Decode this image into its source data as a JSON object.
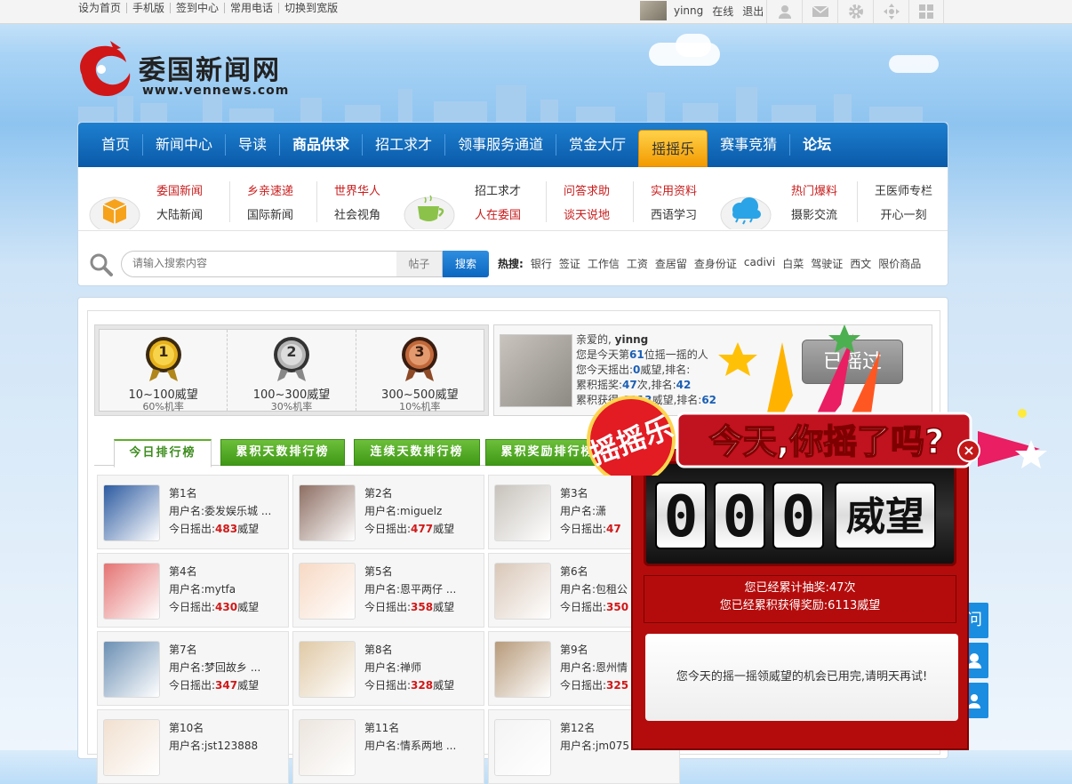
{
  "topbar": {
    "links": [
      "设为首页",
      "手机版",
      "签到中心",
      "常用电话",
      "切换到宽版"
    ],
    "username": "yinng",
    "status": "在线",
    "logout": "退出",
    "icons": [
      "user-icon",
      "mail-icon",
      "gear-icon",
      "move-icon",
      "grid-icon"
    ]
  },
  "logo": {
    "name": "委国新闻网",
    "url": "www.vennews.com"
  },
  "nav": {
    "items": [
      {
        "label": "首页"
      },
      {
        "label": "新闻中心"
      },
      {
        "label": "导读"
      },
      {
        "label": "商品供求"
      },
      {
        "label": "招工求才"
      },
      {
        "label": "领事服务通道"
      },
      {
        "label": "赏金大厅"
      },
      {
        "label": "摇摇乐"
      },
      {
        "label": "赛事竞猜"
      },
      {
        "label": "论坛"
      }
    ]
  },
  "subnav": {
    "groups": [
      [
        "委国新闻",
        "大陆新闻"
      ],
      [
        "乡亲速递",
        "国际新闻"
      ],
      [
        "世界华人",
        "社会视角"
      ],
      [
        "招工求才",
        "人在委国"
      ],
      [
        "问答求助",
        "谈天说地"
      ],
      [
        "实用资料",
        "西语学习"
      ],
      [
        "热门爆料",
        "摄影交流"
      ],
      [
        "王医师专栏",
        "开心一刻"
      ]
    ]
  },
  "search": {
    "placeholder": "请输入搜索内容",
    "type": "帖子",
    "button": "搜索",
    "hot_label": "热搜:",
    "hot_terms": [
      "银行",
      "签证",
      "工作信",
      "工资",
      "查居留",
      "查身份证",
      "cadivi",
      "白菜",
      "驾驶证",
      "西文",
      "限价商品"
    ]
  },
  "medals": [
    {
      "num": "1",
      "range": "10~100威望",
      "rate": "60%机率"
    },
    {
      "num": "2",
      "range": "100~300威望",
      "rate": "30%机率"
    },
    {
      "num": "3",
      "range": "300~500威望",
      "rate": "10%机率"
    }
  ],
  "usercard": {
    "greeting": "亲爱的,",
    "name": "yinng",
    "line2_pre": "您是今天第",
    "line2_num": "61",
    "line2_post": "位摇一摇的人",
    "line3": "您今天摇出:",
    "line3_num": "0",
    "line3_post": "威望,排名:",
    "line4": "累积摇奖:",
    "line4_num": "47",
    "line4_post": "次,排名:",
    "line4_rank": "42",
    "line5": "累积获得:",
    "line5_num": "6113",
    "line5_post": "威望,排名:",
    "line5_rank": "62",
    "button": "已摇过"
  },
  "tabs": [
    "今日排行榜",
    "累积天数排行榜",
    "连续天数排行榜",
    "累积奖励排行榜"
  ],
  "ranks": [
    {
      "pos": "第1名",
      "user": "用户名:委发娱乐城 ...",
      "today_pre": "今日摇出:",
      "value": "483",
      "unit": "威望"
    },
    {
      "pos": "第2名",
      "user": "用户名:miguelz",
      "today_pre": "今日摇出:",
      "value": "477",
      "unit": "威望"
    },
    {
      "pos": "第3名",
      "user": "用户名:潇",
      "today_pre": "今日摇出:",
      "value": "47",
      "unit": ""
    },
    {
      "pos": "第4名",
      "user": "用户名:mytfa",
      "today_pre": "今日摇出:",
      "value": "430",
      "unit": "威望"
    },
    {
      "pos": "第5名",
      "user": "用户名:恩平两仔 ...",
      "today_pre": "今日摇出:",
      "value": "358",
      "unit": "威望"
    },
    {
      "pos": "第6名",
      "user": "用户名:包租公",
      "today_pre": "今日摇出:",
      "value": "350",
      "unit": ""
    },
    {
      "pos": "第7名",
      "user": "用户名:梦回故乡 ...",
      "today_pre": "今日摇出:",
      "value": "347",
      "unit": "威望"
    },
    {
      "pos": "第8名",
      "user": "用户名:禅师",
      "today_pre": "今日摇出:",
      "value": "328",
      "unit": "威望"
    },
    {
      "pos": "第9名",
      "user": "用户名:恩州情",
      "today_pre": "今日摇出:",
      "value": "325",
      "unit": ""
    },
    {
      "pos": "第10名",
      "user": "用户名:jst123888",
      "today_pre": "",
      "value": "",
      "unit": ""
    },
    {
      "pos": "第11名",
      "user": "用户名:情系两地 ...",
      "today_pre": "",
      "value": "",
      "unit": ""
    },
    {
      "pos": "第12名",
      "user": "用户名:jm075",
      "today_pre": "",
      "value": "",
      "unit": ""
    }
  ],
  "popup": {
    "banner_badge": "摇摇乐",
    "banner_text": "今天,你摇了吗?",
    "digits": [
      "0",
      "0",
      "0"
    ],
    "unit": "威望",
    "stat1": "您已经累计抽奖:47次",
    "stat2": "您已经累积获得奖励:6113威望",
    "message": "您今天的摇一摇领威望的机会已用完,请明天再试!",
    "close": "×"
  },
  "side_buttons": [
    "ask-icon",
    "chat-icon",
    "profile-icon"
  ],
  "colors": {
    "nav_blue": "#0a5aa8",
    "accent_red": "#c91d1d",
    "tab_green": "#3f9816",
    "popup_red": "#b40c0c",
    "active_tab": "#f39a00"
  }
}
